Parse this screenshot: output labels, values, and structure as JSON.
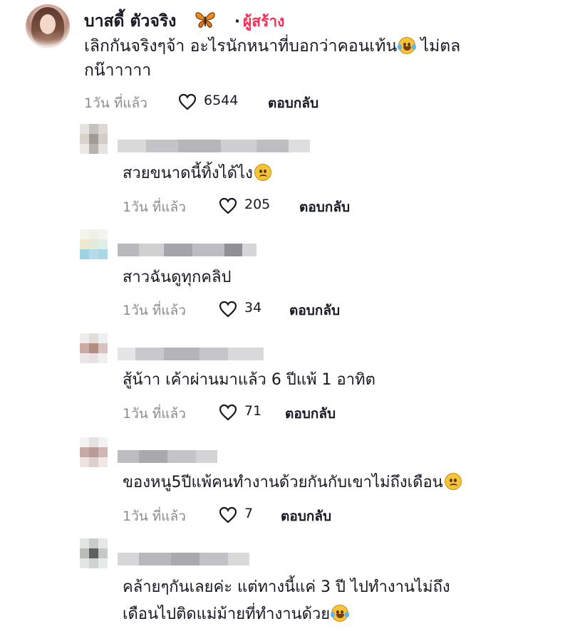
{
  "main_comment": {
    "author": "บาสดี้ ตัวจริง",
    "creator_badge": "ผู้สร้าง",
    "text_line1": "เลิกกันจริงๆจ้า อะไรนักหนาที่บอกว่าคอนเท้น",
    "text_line1_after": " ไม่ตล",
    "text_line2": "กน๊าาาาา",
    "time": "1วัน ที่แล้ว",
    "likes": "6544",
    "reply": "ตอบกลับ"
  },
  "replies": [
    {
      "text": "สวยขนาดนี้ทิ้งได้ไง",
      "emoji": "frown-emoji",
      "time": "1วัน ที่แล้ว",
      "likes": "205",
      "reply": "ตอบกลับ"
    },
    {
      "text": "สาวฉันดูทุกคลิป",
      "time": "1วัน ที่แล้ว",
      "likes": "34",
      "reply": "ตอบกลับ"
    },
    {
      "text": "สู้น้าา เค้าผ่านมาแล้ว 6 ปีแพ้ 1 อาทิต",
      "time": "1วัน ที่แล้ว",
      "likes": "71",
      "reply": "ตอบกลับ"
    },
    {
      "text": "ของหนู5ปีแพ้คนทำงานด้วยกันกับเขาไม่ถึงเดือน",
      "emoji": "frown-emoji",
      "time": "1วัน ที่แล้ว",
      "likes": "7",
      "reply": "ตอบกลับ"
    },
    {
      "text_line1": "คล้ายๆกันเลยค่ะ แต่ทางนี้แค่ 3 ปี ไปทำงานไม่ถึง",
      "text_line2": "เดือนไปติดแม่ม้ายที่ทำงานด้วย",
      "emoji": "laugh-emoji"
    }
  ],
  "colors": {
    "creator": "#fe2c55",
    "meta": "#8a8b91",
    "text": "#161823"
  }
}
